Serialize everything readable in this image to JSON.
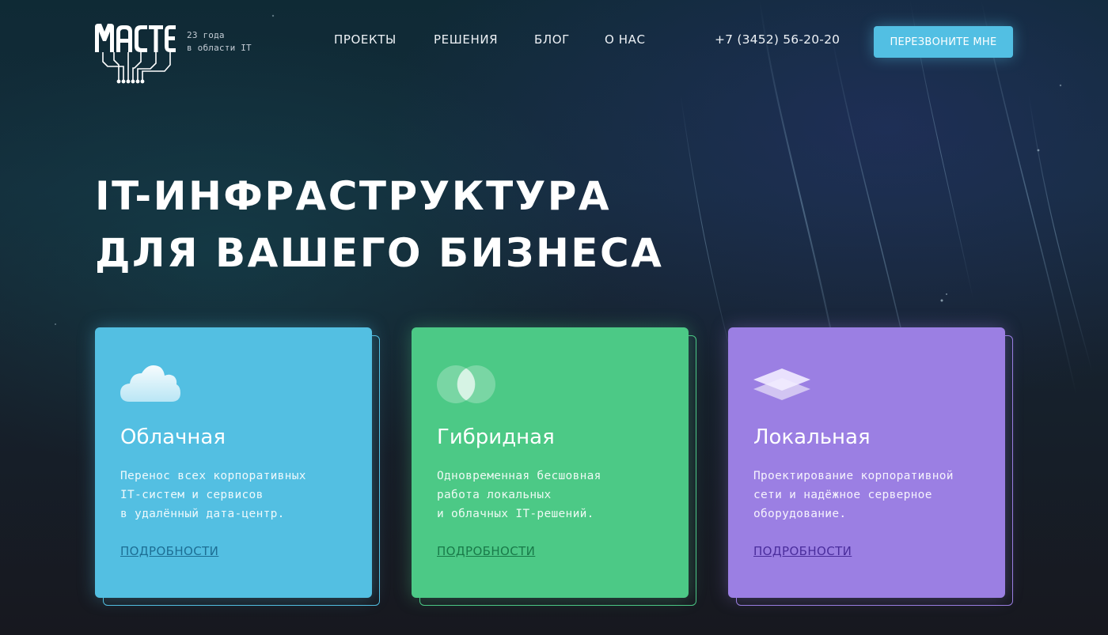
{
  "header": {
    "logo_text": "МАСТЕЛ",
    "tagline_line1": "23 года",
    "tagline_line2": "в области IT",
    "nav": [
      {
        "label": "ПРОЕКТЫ"
      },
      {
        "label": "РЕШЕНИЯ"
      },
      {
        "label": "БЛОГ"
      },
      {
        "label": "О НАС"
      }
    ],
    "phone": "+7 (3452) 56-20-20",
    "cta_label": "ПЕРЕЗВОНИТЕ МНЕ"
  },
  "hero": {
    "title_line1": "IT-ИНФРАСТРУКТУРА",
    "title_line2": "ДЛЯ ВАШЕГО БИЗНЕСА"
  },
  "cards": [
    {
      "icon": "cloud-icon",
      "title": "Облачная",
      "desc": [
        "Перенос всех корпоративных",
        "IT-систем и сервисов",
        "в удалённый дата-центр."
      ],
      "link": "ПОДРОБНОСТИ",
      "color": "#53bfe2",
      "link_color": "#1d6e94"
    },
    {
      "icon": "hybrid-circles-icon",
      "title": "Гибридная",
      "desc": [
        "Одновременная бесшовная",
        "работа локальных",
        "и облачных IT-решений."
      ],
      "link": "ПОДРОБНОСТИ",
      "color": "#4cc986",
      "link_color": "#197a49"
    },
    {
      "icon": "layers-icon",
      "title": "Локальная",
      "desc": [
        "Проектирование корпоративной",
        "сети и надёжное серверное",
        "оборудование."
      ],
      "link": "ПОДРОБНОСТИ",
      "color": "#9b7fe3",
      "link_color": "#4a2d9c"
    }
  ]
}
